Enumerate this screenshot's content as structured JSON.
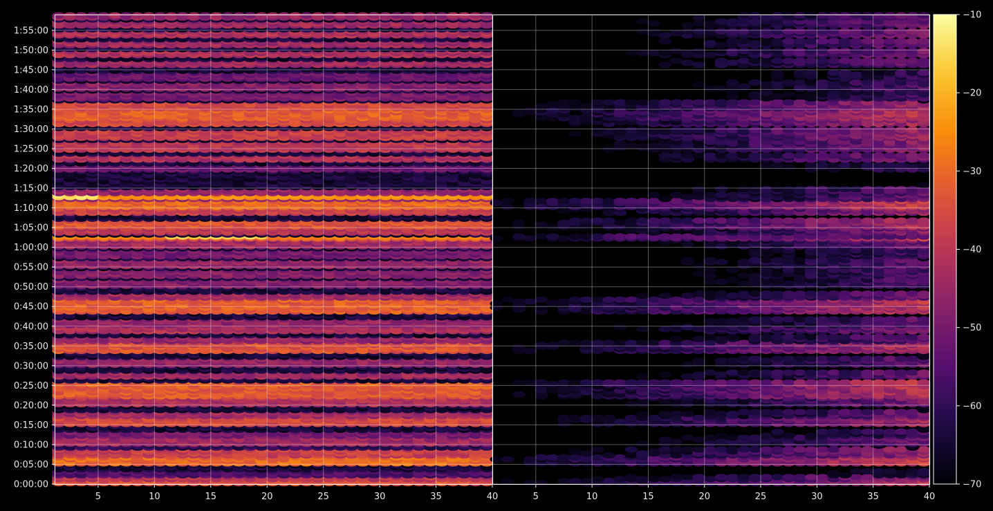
{
  "chart_data": {
    "type": "heatmap",
    "title": "",
    "xlabel": "",
    "ylabel": "",
    "colormap": "inferno",
    "background": "#000000",
    "grid": true,
    "panels": [
      {
        "name": "",
        "xlim": [
          1.2,
          40
        ],
        "x_ticks": [
          "5",
          "10",
          "15",
          "20",
          "25",
          "30",
          "35",
          "40"
        ],
        "x_tick_values": [
          5,
          10,
          15,
          20,
          25,
          30,
          35,
          40
        ],
        "x_range_covered": [
          1,
          39
        ],
        "level_profile": "strong"
      },
      {
        "name": "",
        "xlim": [
          1.2,
          40
        ],
        "x_ticks": [
          "5",
          "10",
          "15",
          "20",
          "25",
          "30",
          "35",
          "40"
        ],
        "x_tick_values": [
          5,
          10,
          15,
          20,
          25,
          30,
          35,
          40
        ],
        "x_range_covered": [
          1,
          39
        ],
        "level_profile": "weak, increasing toward x=40"
      }
    ],
    "y_axis": {
      "unit": "time",
      "range_seconds": [
        0,
        7140
      ],
      "ticks": [
        "0:00:00",
        "0:05:00",
        "0:10:00",
        "0:15:00",
        "0:20:00",
        "0:25:00",
        "0:30:00",
        "0:35:00",
        "0:40:00",
        "0:45:00",
        "0:50:00",
        "0:55:00",
        "1:00:00",
        "1:05:00",
        "1:10:00",
        "1:15:00",
        "1:20:00",
        "1:25:00",
        "1:30:00",
        "1:35:00",
        "1:40:00",
        "1:45:00",
        "1:50:00",
        "1:55:00"
      ],
      "tick_seconds": [
        0,
        300,
        600,
        900,
        1200,
        1500,
        1800,
        2100,
        2400,
        2700,
        3000,
        3300,
        3600,
        3900,
        4200,
        4500,
        4800,
        5100,
        5400,
        5700,
        6000,
        6300,
        6600,
        6900
      ]
    },
    "colorbar": {
      "range": [
        -70,
        -10
      ],
      "ticks": [
        "-10",
        "-20",
        "-30",
        "-40",
        "-50",
        "-60",
        "-70"
      ],
      "tick_values": [
        -10,
        -20,
        -30,
        -40,
        -50,
        -60,
        -70
      ]
    },
    "notable_rows": [
      {
        "time": "1:12:45",
        "peak_value": -14,
        "panel": 1
      },
      {
        "time": "1:02:30",
        "peak_value": -13,
        "panel": 1
      },
      {
        "time": "1:02:30",
        "peak_value": -55,
        "panel": 2
      }
    ]
  }
}
